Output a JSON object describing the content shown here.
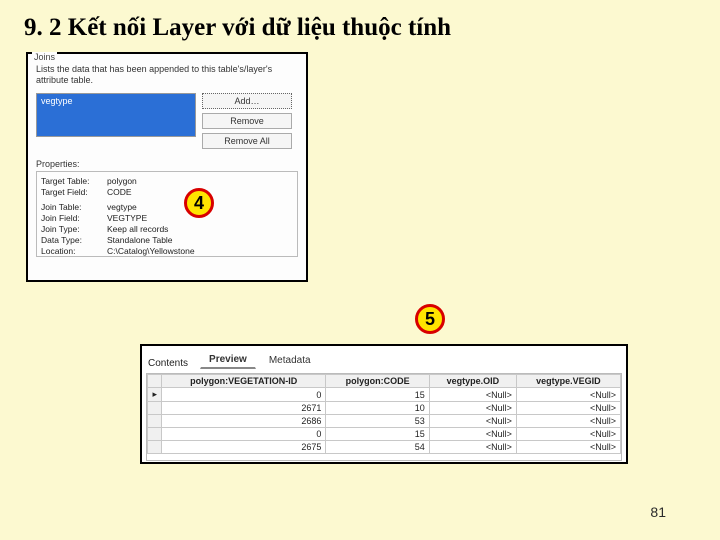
{
  "title": "9. 2 Kết nối Layer với dữ liệu thuộc tính",
  "page_number": "81",
  "joins_panel": {
    "label": "Joins",
    "description": "Lists the data that has been appended to this table's/layer's attribute table.",
    "selected_item": "vegtype",
    "buttons": {
      "add": "Add…",
      "remove": "Remove",
      "remove_all": "Remove All"
    },
    "properties_label": "Properties:",
    "properties": {
      "target_table_label": "Target Table:",
      "target_table": "polygon",
      "target_field_label": "Target Field:",
      "target_field": "CODE",
      "join_table_label": "Join Table:",
      "join_table": "vegtype",
      "join_field_label": "Join Field:",
      "join_field": "VEGTYPE",
      "join_type_label": "Join Type:",
      "join_type": "Keep all records",
      "data_type_label": "Data Type:",
      "data_type": "Standalone Table",
      "location_label": "Location:",
      "location": "C:\\Catalog\\Yellowstone"
    }
  },
  "markers": {
    "m4": "4",
    "m5": "5"
  },
  "preview": {
    "tabs_lead": "Contents",
    "tab_preview": "Preview",
    "tab_metadata": "Metadata",
    "columns": {
      "c0": "",
      "c1": "polygon:VEGETATION-ID",
      "c2": "polygon:CODE",
      "c3": "vegtype.OID",
      "c4": "vegtype.VEGID"
    },
    "rows": [
      {
        "c1": "0",
        "c2": "15",
        "c3": "<Null>",
        "c4": "<Null>"
      },
      {
        "c1": "2671",
        "c2": "10",
        "c3": "<Null>",
        "c4": "<Null>"
      },
      {
        "c1": "2686",
        "c2": "53",
        "c3": "<Null>",
        "c4": "<Null>"
      },
      {
        "c1": "0",
        "c2": "15",
        "c3": "<Null>",
        "c4": "<Null>"
      },
      {
        "c1": "2675",
        "c2": "54",
        "c3": "<Null>",
        "c4": "<Null>"
      }
    ]
  }
}
